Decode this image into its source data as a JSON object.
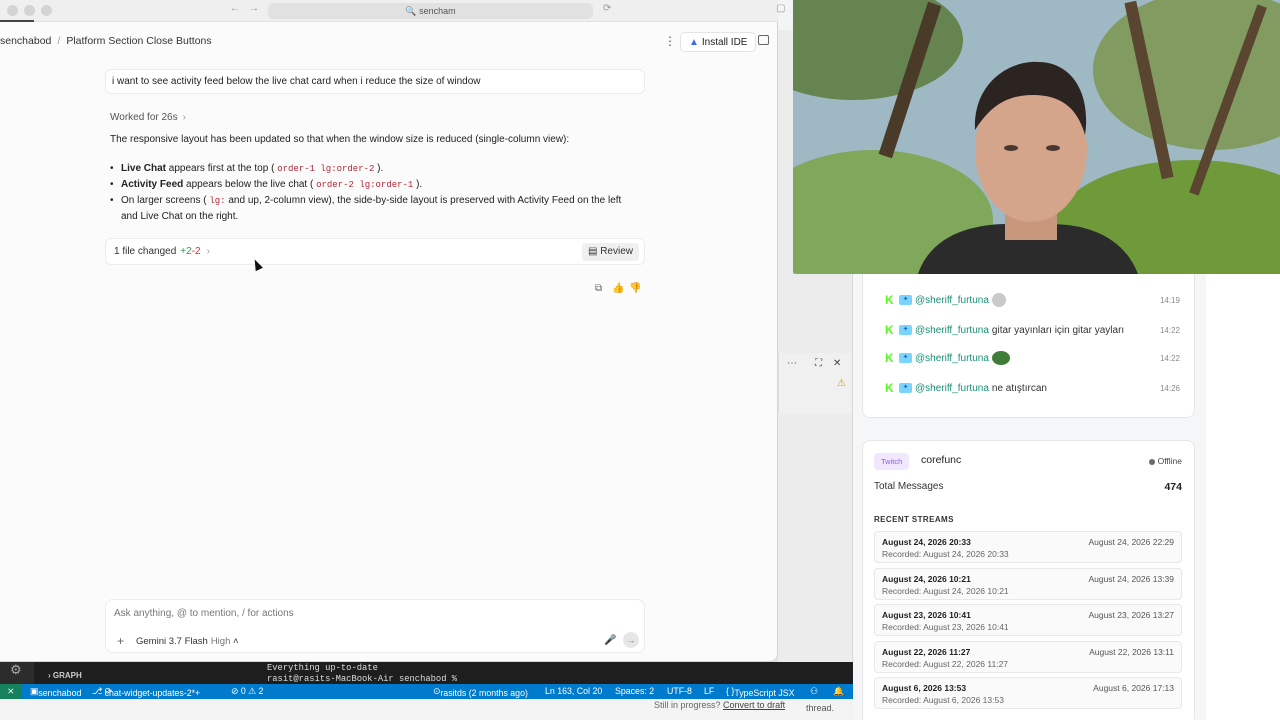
{
  "browser": {
    "url_text": "sencham"
  },
  "breadcrumb": {
    "root": "senchabod",
    "separator": "/",
    "current": "Platform Section Close Buttons"
  },
  "header": {
    "install_ide": "Install IDE",
    "more": "⋮"
  },
  "conversation": {
    "user_message": "i want to see activity feed below the live chat card when i reduce the size of window",
    "worked_label": "Worked for 26s",
    "summary": "The responsive layout has been updated so that when the window size is reduced (single-column view):",
    "bullets": [
      {
        "bold": "Live Chat",
        "pre": " appears first at the top ( ",
        "code": "order-1 lg:order-2",
        "post": " )."
      },
      {
        "bold": "Activity Feed",
        "pre": " appears below the live chat ( ",
        "code": "order-2 lg:order-1",
        "post": " )."
      },
      {
        "pre": "On larger screens ( ",
        "code": "lg:",
        "post": " and up, 2-column view), the side-by-side layout is preserved with Activity Feed on the left and Live Chat on the right."
      }
    ],
    "file_changes": {
      "label": "1 file changed",
      "added": "+2",
      "removed": "-2",
      "review_label": "Review"
    }
  },
  "composer": {
    "placeholder": "Ask anything, @ to mention, / for actions",
    "model": "Gemini 3.7 Flash",
    "level": "High"
  },
  "live_chat": {
    "messages": [
      {
        "user": "@sheriff_furtuna",
        "text": "",
        "time": "14:19",
        "emoji_color": "#c9c9c9"
      },
      {
        "user": "@sheriff_furtuna",
        "text": "gitar yayınları için gitar yayları",
        "time": "14:22",
        "emoji_color": ""
      },
      {
        "user": "@sheriff_furtuna",
        "text": "",
        "time": "14:22",
        "emoji_color": "#3f7c3a"
      },
      {
        "user": "@sheriff_furtuna",
        "text": "ne atıştırcan",
        "time": "14:26",
        "emoji_color": ""
      }
    ]
  },
  "stream_card": {
    "platform": "Twitch",
    "channel": "corefunc",
    "status": "Offline",
    "total_label": "Total Messages",
    "total_value": "474",
    "recent_title": "RECENT STREAMS",
    "streams": [
      {
        "start": "August 24, 2026 20:33",
        "end": "August 24, 2026 22:29",
        "recorded": "Recorded: August 24, 2026 20:33"
      },
      {
        "start": "August 24, 2026 10:21",
        "end": "August 24, 2026 13:39",
        "recorded": "Recorded: August 24, 2026 10:21"
      },
      {
        "start": "August 23, 2026 10:41",
        "end": "August 23, 2026 13:27",
        "recorded": "Recorded: August 23, 2026 10:41"
      },
      {
        "start": "August 22, 2026 11:27",
        "end": "August 22, 2026 13:11",
        "recorded": "Recorded: August 22, 2026 11:27"
      },
      {
        "start": "August 6, 2026 13:53",
        "end": "August 6, 2026 17:13",
        "recorded": "Recorded: August 6, 2026 13:53"
      }
    ]
  },
  "vscode": {
    "graph_label": "GRAPH",
    "terminal_lines": [
      "Everything up-to-date",
      "rasit@rasits-MacBook-Air senchabod % "
    ],
    "status": {
      "folder": "senchabod",
      "branch": "chat-widget-updates-2*+",
      "problems": "⊘ 0 ⚠ 2",
      "blame": "rasitds (2 months ago)",
      "position": "Ln 163, Col 20",
      "spaces": "Spaces: 2",
      "encoding": "UTF-8",
      "eol": "LF",
      "language": "TypeScript JSX"
    }
  },
  "bottom": {
    "still_in_progress": "Still in progress?",
    "convert_link": "Convert to draft",
    "thread": "thread."
  }
}
